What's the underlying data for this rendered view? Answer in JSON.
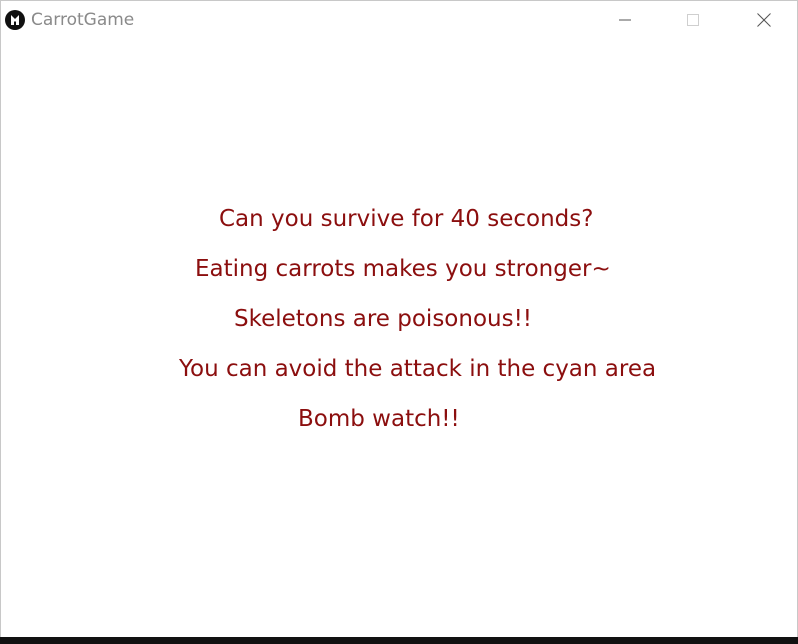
{
  "window": {
    "title": "CarrotGame",
    "icon": "carrot-game-app-icon",
    "controls": {
      "minimize_icon": "minimize-icon",
      "maximize_icon": "maximize-icon",
      "close_icon": "close-icon"
    }
  },
  "messages": [
    "Can you survive for 40 seconds?",
    "Eating carrots makes you stronger~",
    "Skeletons are poisonous!!",
    "You can avoid the attack in the cyan area",
    "Bomb watch!!"
  ],
  "colors": {
    "message_text": "#8b0e0e",
    "title_text": "#8a8a8a",
    "background": "#ffffff"
  }
}
